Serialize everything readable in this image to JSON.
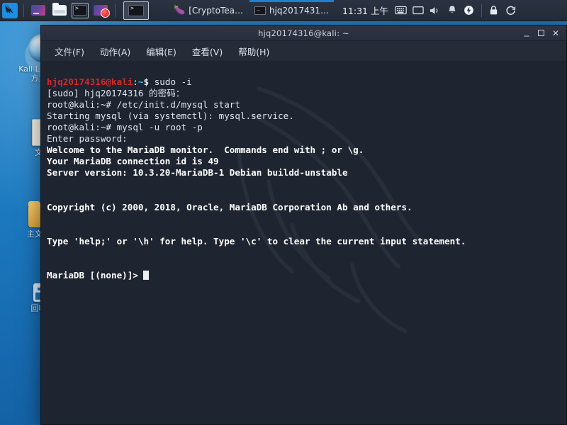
{
  "panel": {
    "start_button": "Kali Menu",
    "launchers": [
      {
        "name": "files-manager",
        "label": "Files"
      },
      {
        "name": "file-browser",
        "label": "File Browser"
      },
      {
        "name": "terminal",
        "label": "Terminal"
      },
      {
        "name": "burp-suite",
        "label": "Burp Suite"
      }
    ],
    "windows": [
      {
        "label": "[CryptoTea…",
        "active": true,
        "icon": "crypto-icon"
      },
      {
        "label": "hjq2017431…",
        "active": false,
        "icon": "terminal-icon"
      }
    ],
    "clock": "11:31 上午",
    "tray": [
      {
        "name": "keyboard-layout-icon",
        "glyph": "⌨"
      },
      {
        "name": "display-icon",
        "glyph": "▭"
      },
      {
        "name": "volume-icon",
        "glyph": "🔈"
      },
      {
        "name": "notifications-bell-icon",
        "glyph": "🔔"
      },
      {
        "name": "power-manager-icon",
        "glyph": "⚡"
      },
      {
        "name": "lock-screen-icon",
        "glyph": "🔒"
      },
      {
        "name": "logout-icon",
        "glyph": "↺"
      }
    ]
  },
  "desktop": {
    "icons": [
      {
        "name": "desktop-icon-kali-docs",
        "label": "Kali Linux 官方文档",
        "glyph": "globe-icon"
      },
      {
        "name": "desktop-icon-documents",
        "label": "文件",
        "glyph": "document-icon"
      },
      {
        "name": "desktop-icon-home-folder",
        "label": "主文件夹",
        "glyph": "folder-icon"
      },
      {
        "name": "desktop-icon-trash",
        "label": "回收站",
        "glyph": "trash-icon"
      }
    ]
  },
  "window": {
    "title": "hjq20174316@kali: ~",
    "controls": {
      "minimize": "–",
      "maximize": "",
      "close": "✕"
    },
    "menu": [
      {
        "name": "menu-file",
        "label": "文件(F)"
      },
      {
        "name": "menu-actions",
        "label": "动作(A)"
      },
      {
        "name": "menu-edit",
        "label": "编辑(E)"
      },
      {
        "name": "menu-view",
        "label": "查看(V)"
      },
      {
        "name": "menu-help",
        "label": "帮助(H)"
      }
    ]
  },
  "terminal": {
    "prompt1": {
      "user": "hjq20174316@kali",
      "colon": ":",
      "path": "~",
      "sigil": "$",
      "command": " sudo -i"
    },
    "lines": [
      "[sudo] hjq20174316 的密码：",
      "root@kali:~# /etc/init.d/mysql start",
      "Starting mysql (via systemctl): mysql.service.",
      "root@kali:~# mysql -u root -p",
      "Enter password:"
    ],
    "mariadb_lines": [
      "Welcome to the MariaDB monitor.  Commands end with ; or \\g.",
      "Your MariaDB connection id is 49",
      "Server version: 10.3.20-MariaDB-1 Debian buildd-unstable"
    ],
    "copyright": "Copyright (c) 2000, 2018, Oracle, MariaDB Corporation Ab and others.",
    "help_hint": "Type 'help;' or '\\h' for help. Type '\\c' to clear the current input statement.",
    "final_prompt": "MariaDB [(none)]> "
  },
  "colors": {
    "panel_bg": "#2b3342",
    "terminal_bg": "#1e2430",
    "window_bg": "#252b37",
    "prompt_user": "#d32a2a",
    "prompt_path": "#3fb8d8",
    "text": "#dfe6ef",
    "desktop_blue": "#1b6fb5",
    "taskbar_active": "#1f7fd0"
  }
}
